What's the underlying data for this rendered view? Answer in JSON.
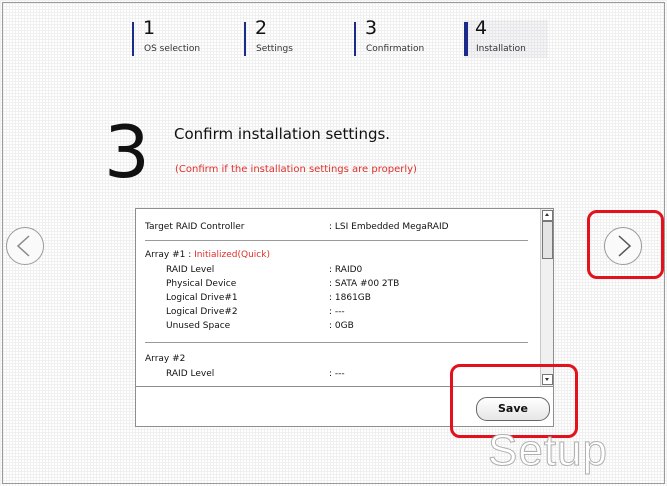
{
  "steps": [
    {
      "num": "1",
      "label": "OS selection"
    },
    {
      "num": "2",
      "label": "Settings"
    },
    {
      "num": "3",
      "label": "Confirmation"
    },
    {
      "num": "4",
      "label": "Installation"
    }
  ],
  "page": {
    "step_number": "3",
    "heading": "Confirm installation settings.",
    "subheading": "(Confirm if the installation settings are properly)"
  },
  "settings": {
    "controller_label": "Target RAID Controller",
    "controller_value": ": LSI Embedded MegaRAID",
    "array1": {
      "title": "Array #1 : ",
      "status": "Initialized(Quick)",
      "rows": [
        {
          "label": "RAID Level",
          "value": ": RAID0"
        },
        {
          "label": "Physical Device",
          "value": ": SATA #00 2TB"
        },
        {
          "label": "Logical Drive#1",
          "value": ": 1861GB"
        },
        {
          "label": "Logical Drive#2",
          "value": ": ---"
        },
        {
          "label": "Unused Space",
          "value": ": 0GB"
        }
      ]
    },
    "array2": {
      "title": "Array #2",
      "rows": [
        {
          "label": "RAID Level",
          "value": ": ---"
        }
      ]
    }
  },
  "buttons": {
    "save": "Save"
  },
  "watermark": "Setup",
  "colors": {
    "accent_bar": "#1b2b8a",
    "warning_text": "#e0302a",
    "highlight": "#e3111b"
  }
}
